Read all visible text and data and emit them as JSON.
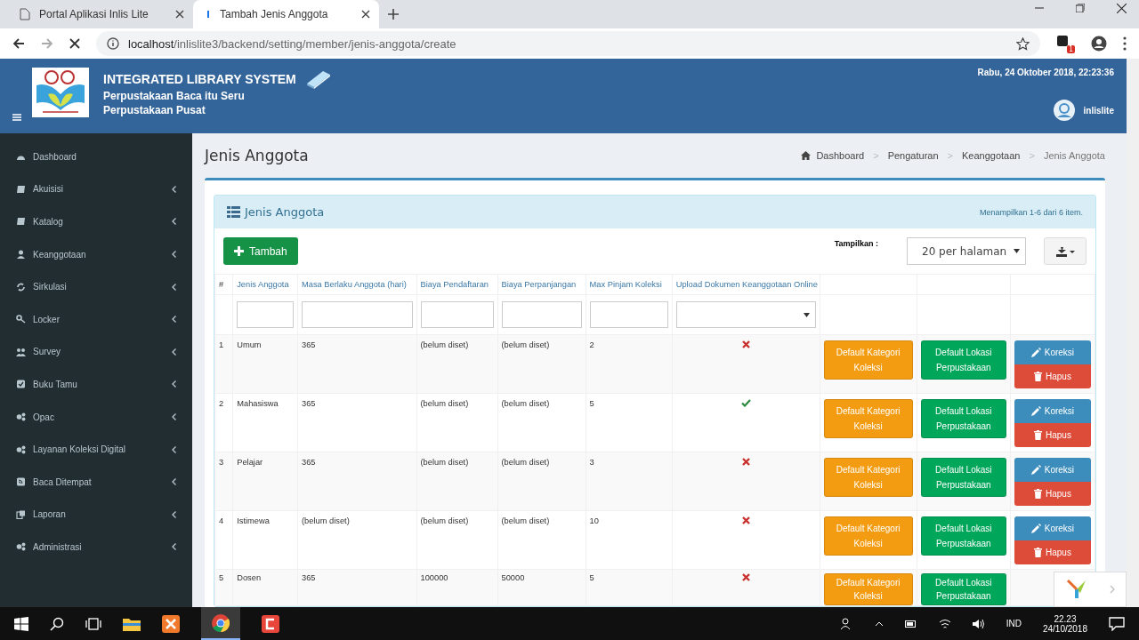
{
  "browser": {
    "tabs": [
      {
        "title": "Portal Aplikasi Inlis Lite",
        "selected": false
      },
      {
        "title": "Tambah Jenis Anggota",
        "selected": true
      }
    ],
    "url_host": "localhost",
    "url_path": "/inlislite3/backend/setting/member/jenis-anggota/create",
    "extension_badge": "1"
  },
  "header": {
    "title": "INTEGRATED LIBRARY SYSTEM",
    "lines": [
      "Perpustakaan Baca itu Seru",
      "Perpustakaan Pusat"
    ],
    "datetime": "Rabu, 24 Oktober 2018, 22:23:36",
    "user": "inlislite"
  },
  "sidebar": {
    "items": [
      {
        "label": "Dashboard",
        "expandable": false
      },
      {
        "label": "Akuisisi",
        "expandable": true
      },
      {
        "label": "Katalog",
        "expandable": true
      },
      {
        "label": "Keanggotaan",
        "expandable": true
      },
      {
        "label": "Sirkulasi",
        "expandable": true
      },
      {
        "label": "Locker",
        "expandable": true
      },
      {
        "label": "Survey",
        "expandable": true
      },
      {
        "label": "Buku Tamu",
        "expandable": true
      },
      {
        "label": "Opac",
        "expandable": true
      },
      {
        "label": "Layanan Koleksi Digital",
        "expandable": true
      },
      {
        "label": "Baca Ditempat",
        "expandable": true
      },
      {
        "label": "Laporan",
        "expandable": true
      },
      {
        "label": "Administrasi",
        "expandable": true
      }
    ]
  },
  "page": {
    "title": "Jenis Anggota",
    "breadcrumb": [
      "Dashboard",
      "Pengaturan",
      "Keanggotaan",
      "Jenis Anggota"
    ],
    "breadcrumb_separators": [
      ">",
      ">",
      ">"
    ]
  },
  "panel": {
    "title": "Jenis Anggota",
    "summary": "Menampilkan 1-6 dari 6 item.",
    "add_button": "Tambah",
    "per_page_label": "Tampilkan :",
    "per_page": "20 per halaman"
  },
  "table": {
    "columns": [
      "#",
      "Jenis Anggota",
      "Masa Berlaku Anggota (hari)",
      "Biaya Pendaftaran",
      "Biaya Perpanjangan",
      "Max Pinjam Koleksi",
      "Upload Dokumen Keanggotaan Online"
    ],
    "rows": [
      {
        "no": "1",
        "jenis": "Umum",
        "masa": "365",
        "daftar": "(belum diset)",
        "perpanjang": "(belum diset)",
        "max": "2",
        "upload": false,
        "kategori": "Default Kategori Koleksi",
        "lokasi": "Default Lokasi Perpustakaan",
        "edit": "Koreksi",
        "delete": "Hapus"
      },
      {
        "no": "2",
        "jenis": "Mahasiswa",
        "masa": "365",
        "daftar": "(belum diset)",
        "perpanjang": "(belum diset)",
        "max": "5",
        "upload": true,
        "kategori": "Default Kategori Koleksi",
        "lokasi": "Default Lokasi Perpustakaan",
        "edit": "Koreksi",
        "delete": "Hapus"
      },
      {
        "no": "3",
        "jenis": "Pelajar",
        "masa": "365",
        "daftar": "(belum diset)",
        "perpanjang": "(belum diset)",
        "max": "3",
        "upload": false,
        "kategori": "Default Kategori Koleksi",
        "lokasi": "Default Lokasi Perpustakaan",
        "edit": "Koreksi",
        "delete": "Hapus"
      },
      {
        "no": "4",
        "jenis": "Istimewa",
        "masa": "(belum diset)",
        "daftar": "(belum diset)",
        "perpanjang": "(belum diset)",
        "max": "10",
        "upload": false,
        "kategori": "Default Kategori Koleksi",
        "lokasi": "Default Lokasi Perpustakaan",
        "edit": "Koreksi",
        "delete": "Hapus"
      },
      {
        "no": "5",
        "jenis": "Dosen",
        "masa": "365",
        "daftar": "100000",
        "perpanjang": "50000",
        "max": "5",
        "upload": false,
        "kategori": "Default Kategori Koleksi",
        "lokasi": "Default Lokasi Perpustakaan"
      }
    ]
  },
  "taskbar": {
    "language": "IND",
    "time": "22.23",
    "date": "24/10/2018"
  }
}
